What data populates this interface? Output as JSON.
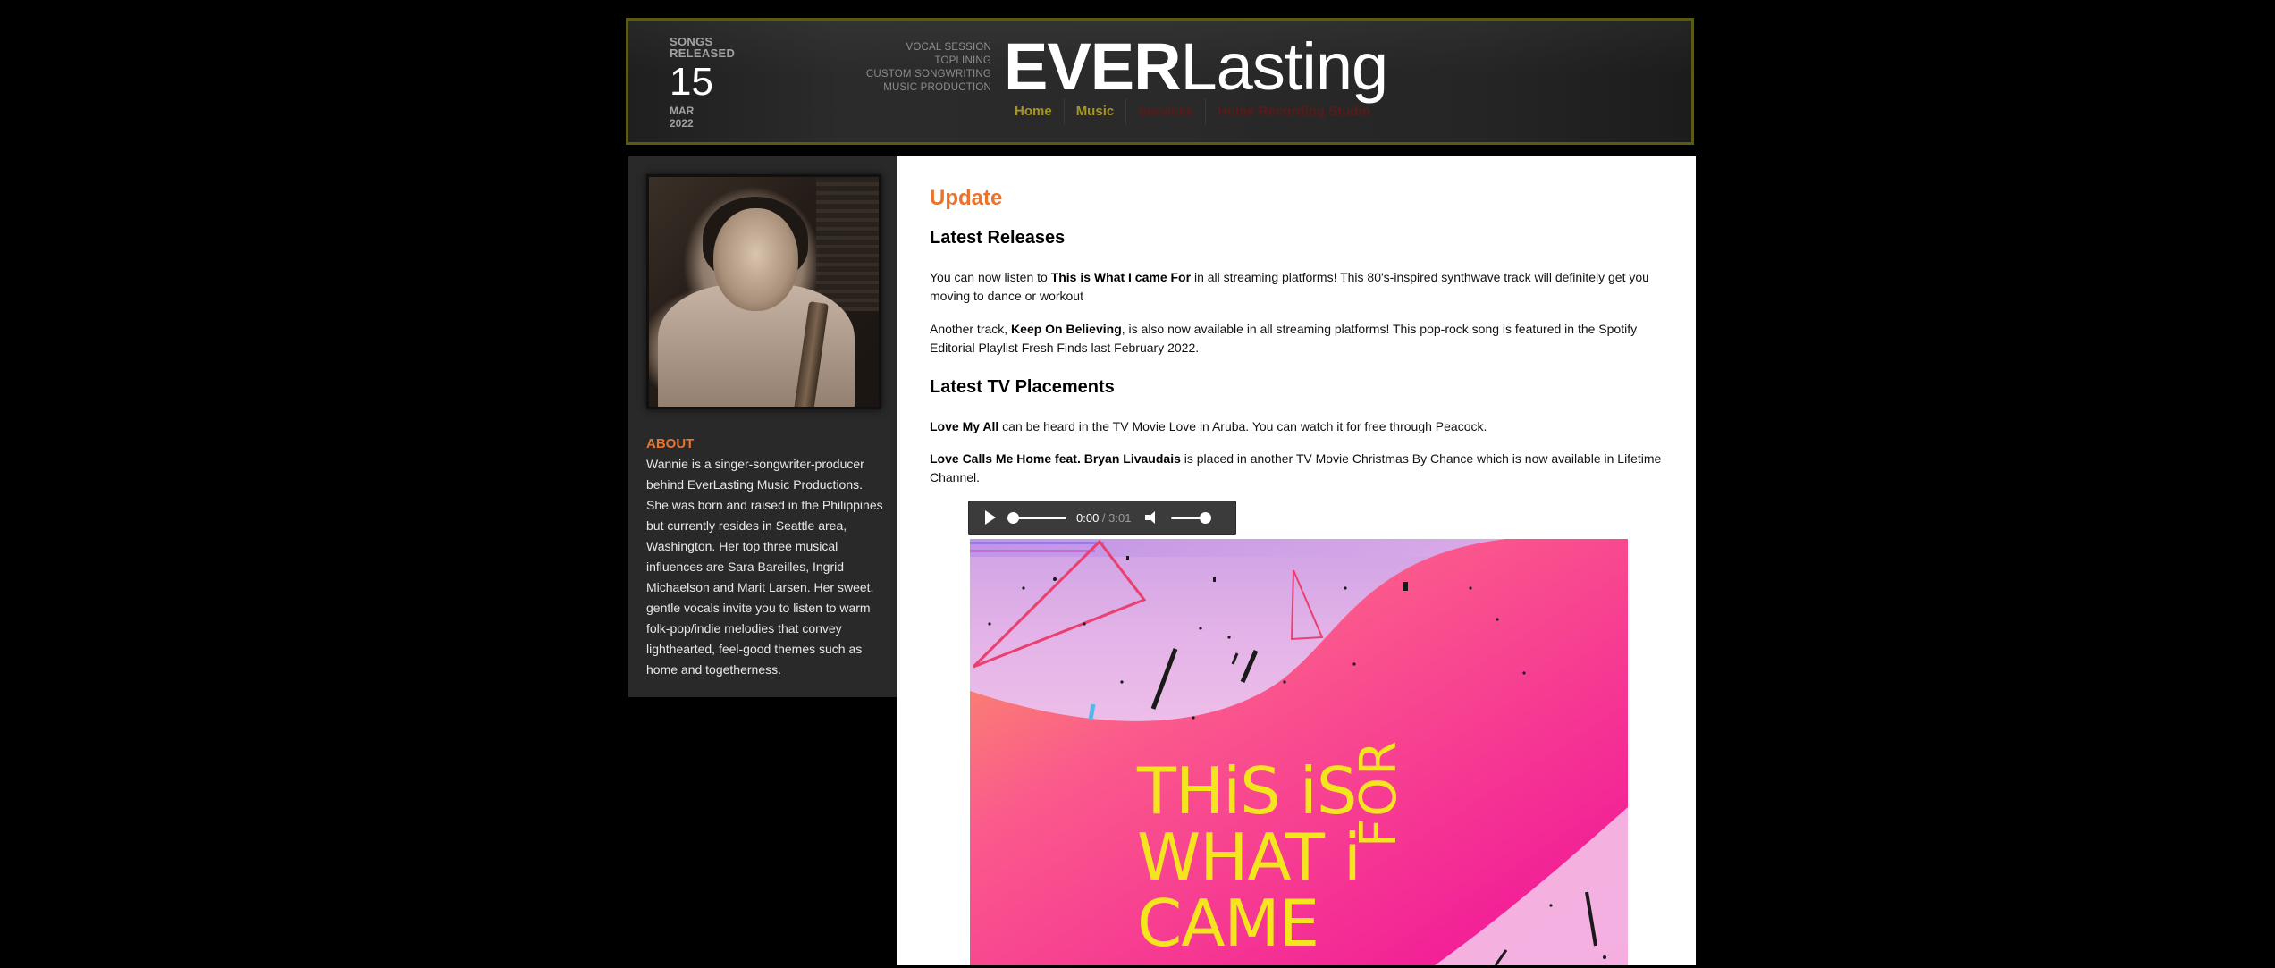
{
  "header": {
    "songs_label_line1": "SONGS",
    "songs_label_line2": "RELEASED",
    "songs_count": "15",
    "songs_month": "MAR",
    "songs_year": "2022",
    "services": [
      "VOCAL SESSION",
      "TOPLINING",
      "CUSTOM SONGWRITING",
      "MUSIC PRODUCTION"
    ],
    "logo_bold": "EVER",
    "logo_light": "Lasting",
    "nav": [
      {
        "label": "Home"
      },
      {
        "label": "Music"
      },
      {
        "label": "Services"
      },
      {
        "label": "Home Recording Studio"
      }
    ]
  },
  "sidebar": {
    "about_title": "ABOUT",
    "about_text": "Wannie is a singer-songwriter-producer behind EverLasting Music Productions. She was born and raised in the Philippines but currently resides in Seattle area, Washington. Her top three musical influences are Sara Bareilles, Ingrid Michaelson and Marit Larsen. Her sweet, gentle vocals invite you to listen to warm folk-pop/indie melodies that convey lighthearted, feel-good themes such as home and togetherness."
  },
  "main": {
    "update_title": "Update",
    "latest_releases_heading": "Latest Releases",
    "p1": {
      "before": "You can now listen to ",
      "bold": "This is What I came For",
      "after": " in all streaming platforms! This 80's-inspired synthwave track will definitely get you moving to dance or workout"
    },
    "p2": {
      "before": "Another track, ",
      "bold": "Keep On Believing",
      "after": ", is also now available in all streaming platforms! This pop-rock song is featured in the Spotify Editorial Playlist Fresh Finds last February 2022."
    },
    "tv_heading": "Latest TV Placements",
    "p3": {
      "bold": "Love My All",
      "after": " can be heard in the TV Movie Love in Aruba. You can watch it for free through Peacock."
    },
    "p4": {
      "bold": "Love Calls Me Home feat. Bryan Livaudais",
      "after": " is placed in another TV Movie Christmas By Chance which is now available in Lifetime Channel."
    },
    "audio": {
      "current_time": "0:00",
      "separator": " / ",
      "duration": "3:01",
      "progress_fraction": 0,
      "volume_fraction": 1
    },
    "cover": {
      "title_lines": [
        "THiS iS",
        "WHAT i",
        "CAME"
      ],
      "title_vertical": "FOR"
    }
  },
  "colors": {
    "accent_orange": "#e9742f",
    "nav_gold": "#a69525",
    "header_border": "#5a5a14",
    "cover_pink": "#f0109a",
    "cover_yellow": "#f4e51e"
  }
}
